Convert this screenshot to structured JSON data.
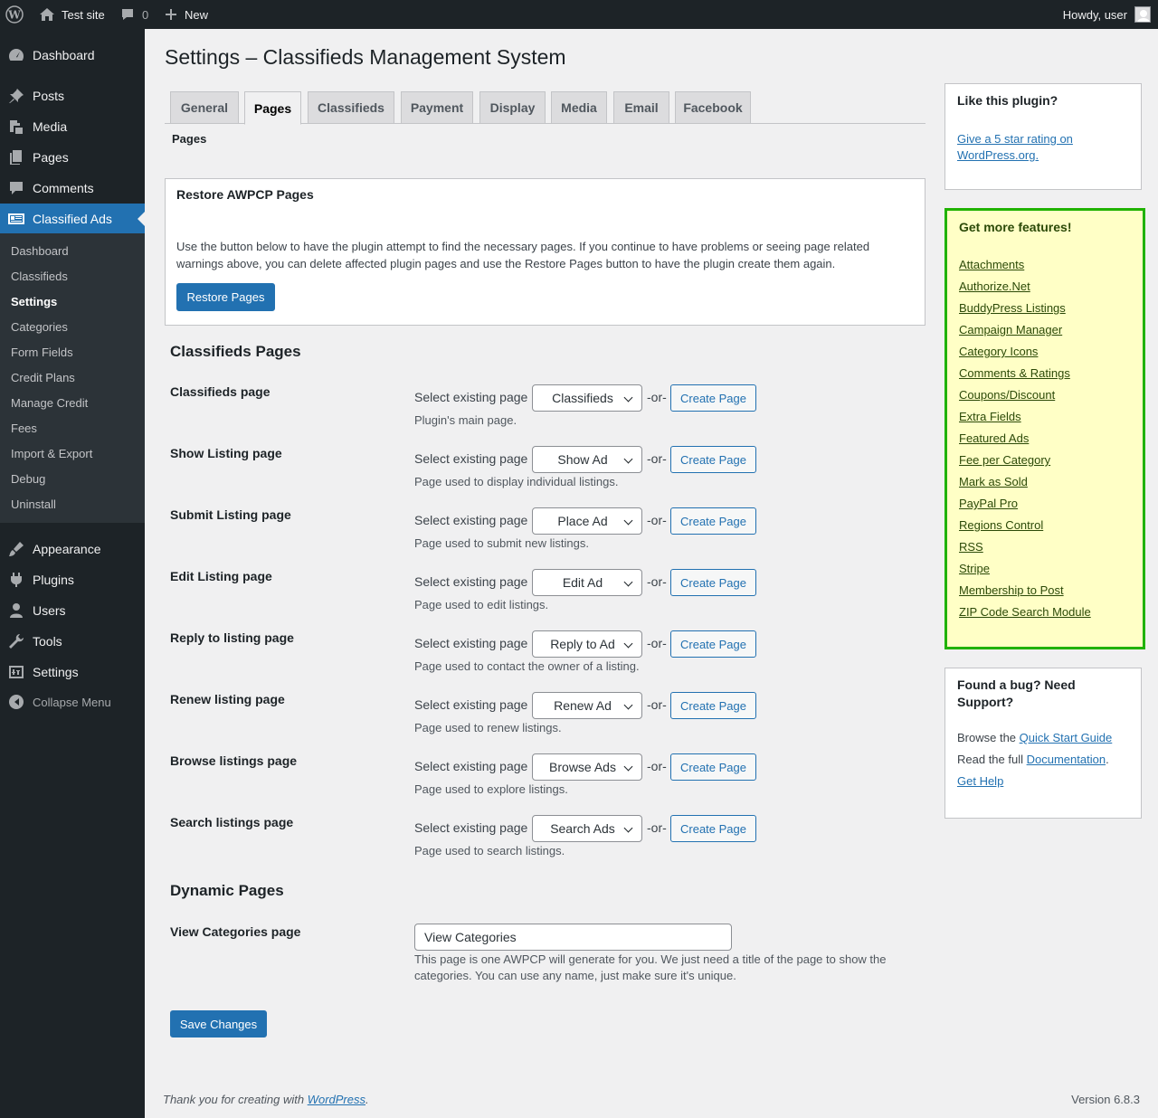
{
  "admin_bar": {
    "site_name": "Test site",
    "comments_count": "0",
    "new_label": "New",
    "howdy": "Howdy, user"
  },
  "sidebar": {
    "menu": [
      {
        "label": "Dashboard",
        "icon": "dashboard-icon"
      },
      {
        "label": "Posts",
        "icon": "pin-icon"
      },
      {
        "label": "Media",
        "icon": "media-icon"
      },
      {
        "label": "Pages",
        "icon": "pages-icon"
      },
      {
        "label": "Comments",
        "icon": "comment-icon"
      },
      {
        "label": "Classified Ads",
        "icon": "classified-icon"
      },
      {
        "label": "Appearance",
        "icon": "brush-icon"
      },
      {
        "label": "Plugins",
        "icon": "plugin-icon"
      },
      {
        "label": "Users",
        "icon": "users-icon"
      },
      {
        "label": "Tools",
        "icon": "wrench-icon"
      },
      {
        "label": "Settings",
        "icon": "settings-icon"
      }
    ],
    "submenu": [
      "Dashboard",
      "Classifieds",
      "Settings",
      "Categories",
      "Form Fields",
      "Credit Plans",
      "Manage Credit",
      "Fees",
      "Import & Export",
      "Debug",
      "Uninstall"
    ],
    "collapse_label": "Collapse Menu"
  },
  "page": {
    "title": "Settings – Classifieds Management System",
    "tabs": [
      "General",
      "Pages",
      "Classifieds",
      "Payment",
      "Display",
      "Media",
      "Email",
      "Facebook"
    ],
    "subsection": "Pages"
  },
  "restore": {
    "title": "Restore AWPCP Pages",
    "text": "Use the button below to have the plugin attempt to find the necessary pages. If you continue to have problems or seeing page related warnings above, you can delete affected plugin pages and use the Restore Pages button to have the plugin create them again.",
    "button": "Restore Pages"
  },
  "classifieds_pages": {
    "heading": "Classifieds Pages",
    "select_text": "Select existing page",
    "or_text": "-or-",
    "create_label": "Create Page",
    "rows": [
      {
        "label": "Classifieds page",
        "value": "Classifieds",
        "desc": "Plugin's main page."
      },
      {
        "label": "Show Listing page",
        "value": "Show Ad",
        "desc": "Page used to display individual listings."
      },
      {
        "label": "Submit Listing page",
        "value": "Place Ad",
        "desc": "Page used to submit new listings."
      },
      {
        "label": "Edit Listing page",
        "value": "Edit Ad",
        "desc": "Page used to edit listings."
      },
      {
        "label": "Reply to listing page",
        "value": "Reply to Ad",
        "desc": "Page used to contact the owner of a listing."
      },
      {
        "label": "Renew listing page",
        "value": "Renew Ad",
        "desc": "Page used to renew listings."
      },
      {
        "label": "Browse listings page",
        "value": "Browse Ads",
        "desc": "Page used to explore listings."
      },
      {
        "label": "Search listings page",
        "value": "Search Ads",
        "desc": "Page used to search listings."
      }
    ]
  },
  "dynamic_pages": {
    "heading": "Dynamic Pages",
    "label": "View Categories page",
    "value": "View Categories",
    "desc": "This page is one AWPCP will generate for you. We just need a title of the page to show the categories. You can use any name, just make sure it's unique."
  },
  "save_button": "Save Changes",
  "footer": {
    "thanks_prefix": "Thank you for creating with ",
    "thanks_link": "WordPress",
    "thanks_suffix": ".",
    "version": "Version 6.8.3"
  },
  "like_box": {
    "title": "Like this plugin?",
    "link": "Give a 5 star rating on WordPress.org."
  },
  "features_box": {
    "title": "Get more features!",
    "items": [
      "Attachments",
      "Authorize.Net",
      "BuddyPress Listings",
      "Campaign Manager",
      "Category Icons",
      "Comments & Ratings",
      "Coupons/Discount",
      "Extra Fields",
      "Featured Ads",
      "Fee per Category",
      "Mark as Sold",
      "PayPal Pro",
      "Regions Control",
      "RSS",
      "Stripe",
      "Membership to Post",
      "ZIP Code Search Module"
    ]
  },
  "support_box": {
    "title": "Found a bug? Need Support?",
    "browse_prefix": "Browse the ",
    "browse_link": "Quick Start Guide",
    "read_prefix": "Read the full ",
    "read_link": "Documentation",
    "read_suffix": ".",
    "help_link": "Get Help"
  },
  "colors": {
    "admin_dark": "#1d2327",
    "accent": "#2271b1",
    "features_bg": "#ffffc6",
    "features_border": "#20b200"
  }
}
